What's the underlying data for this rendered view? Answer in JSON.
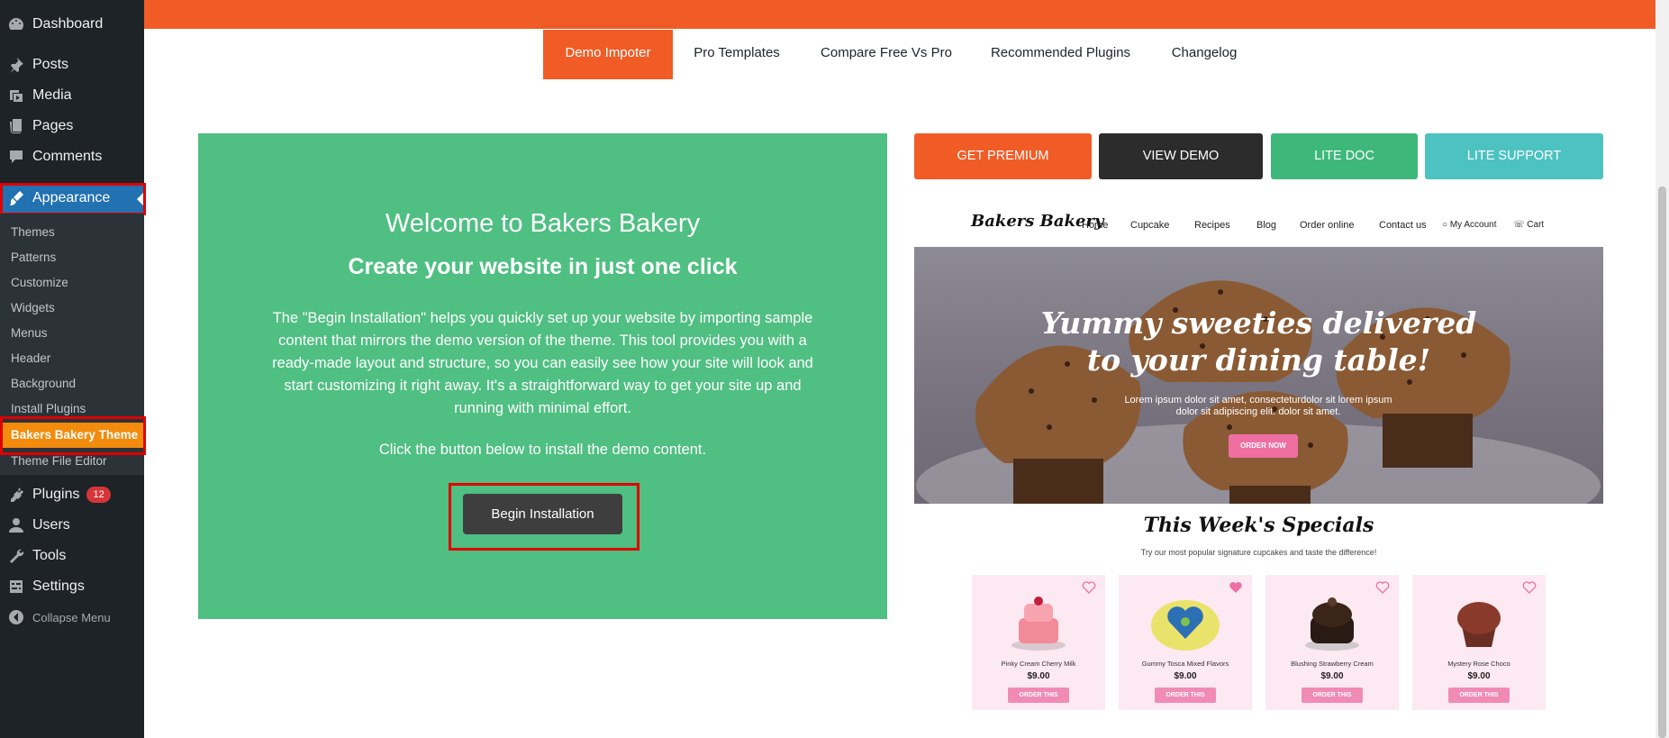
{
  "sidebar": {
    "menu": [
      {
        "label": "Dashboard",
        "icon": "dashboard-icon"
      },
      {
        "label": "Posts",
        "icon": "pin-icon"
      },
      {
        "label": "Media",
        "icon": "media-icon"
      },
      {
        "label": "Pages",
        "icon": "pages-icon"
      },
      {
        "label": "Comments",
        "icon": "comment-icon"
      },
      {
        "label": "Appearance",
        "icon": "brush-icon"
      },
      {
        "label": "Plugins",
        "icon": "plugin-icon",
        "badge": "12"
      },
      {
        "label": "Users",
        "icon": "user-icon"
      },
      {
        "label": "Tools",
        "icon": "wrench-icon"
      },
      {
        "label": "Settings",
        "icon": "settings-icon"
      },
      {
        "label": "Collapse Menu",
        "icon": "collapse-icon"
      }
    ],
    "submenu": [
      "Themes",
      "Patterns",
      "Customize",
      "Widgets",
      "Menus",
      "Header",
      "Background",
      "Install Plugins",
      "Bakers Bakery Theme",
      "Theme File Editor"
    ]
  },
  "tabs": [
    "Demo Impoter",
    "Pro Templates",
    "Compare Free Vs Pro",
    "Recommended Plugins",
    "Changelog"
  ],
  "welcome": {
    "title": "Welcome to Bakers Bakery",
    "subtitle": "Create your website in just one click",
    "description": "The \"Begin Installation\" helps you quickly set up your website by importing sample content that mirrors the demo version of the theme. This tool provides you with a ready-made layout and structure, so you can easily see how your site will look and start customizing it right away. It's a straightforward way to get your site up and running with minimal effort.",
    "note": "Click the button below to install the demo content.",
    "button": "Begin Installation"
  },
  "actions": [
    {
      "label": "GET PREMIUM",
      "color": "#f15c26"
    },
    {
      "label": "VIEW DEMO",
      "color": "#2c2c2c"
    },
    {
      "label": "LITE DOC",
      "color": "#3eb87a"
    },
    {
      "label": "LITE SUPPORT",
      "color": "#4cc2c1"
    }
  ],
  "preview": {
    "logo": "Bakers Bakery",
    "nav": [
      "Home",
      "Cupcake",
      "Recipes",
      "Blog",
      "Order online",
      "Contact us",
      "My Account",
      "Cart"
    ],
    "hero_title_1": "Yummy sweeties delivered",
    "hero_title_2": "to your dining table!",
    "hero_sub": "Lorem ipsum dolor sit amet, consecteturdolor sit lorem ipsum dolor sit adipiscing elit. dolor sit amet.",
    "hero_button": "ORDER NOW",
    "specials_title": "This Week's Specials",
    "specials_sub": "Try our most popular signature cupcakes and taste the difference!",
    "products": [
      {
        "name": "Pinky Cream Cherry Milk",
        "price": "$9.00",
        "button": "ORDER THIS"
      },
      {
        "name": "Gummy Tosca Mixed Flavors",
        "price": "$9.00",
        "button": "ORDER THIS"
      },
      {
        "name": "Blushing Strawberry Cream",
        "price": "$9.00",
        "button": "ORDER THIS"
      },
      {
        "name": "Mystery Rose Choco",
        "price": "$9.00",
        "button": "ORDER THIS"
      }
    ]
  },
  "colors": {
    "accent": "#f15c26",
    "green": "#4fbf82",
    "wp_blue": "#2271b1",
    "highlight": "#f38b0c",
    "outline_red": "#e00000"
  }
}
